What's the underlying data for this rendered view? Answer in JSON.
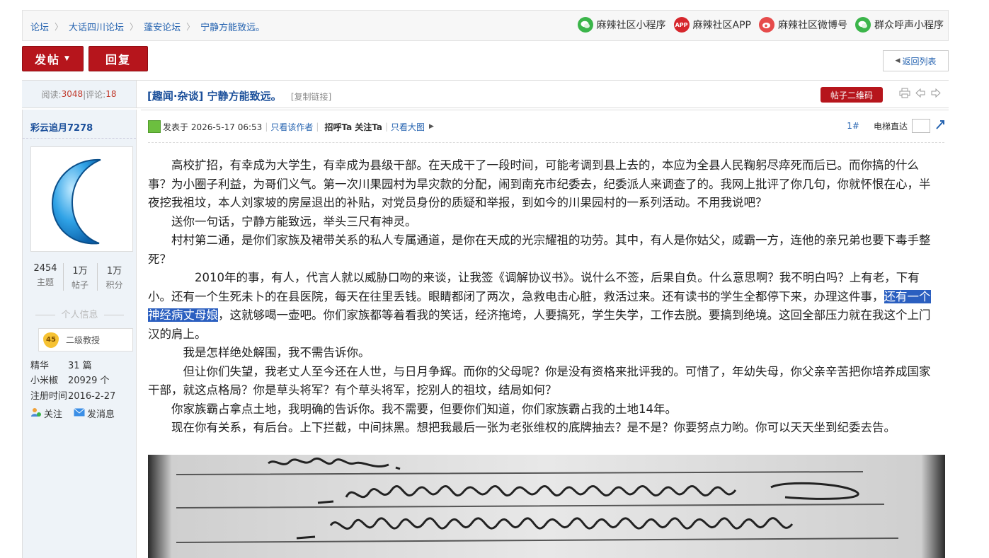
{
  "breadcrumb": [
    "论坛",
    "大话四川论坛",
    "蓬安论坛",
    "宁静方能致远。"
  ],
  "apps": [
    {
      "label": "麻辣社区小程序",
      "icon": "wechat-icon",
      "color": "#3bb54a"
    },
    {
      "label": "麻辣社区APP",
      "icon": "app-icon",
      "color": "#d6262c"
    },
    {
      "label": "麻辣社区微博号",
      "icon": "weibo-icon",
      "color": "#e64b4b"
    },
    {
      "label": "群众呼声小程序",
      "icon": "wechat-icon",
      "color": "#3bb54a"
    }
  ],
  "app_icon_text": "APP",
  "toolbar": {
    "post_label": "发帖",
    "reply_label": "回复",
    "back_label": "返回列表"
  },
  "thread": {
    "read_label": "阅读:",
    "read_count": "3048",
    "comment_label": "|评论:",
    "comment_count": "18",
    "title": "[趣闻·杂谈] 宁静方能致远。",
    "copy_link": "[复制链接]",
    "qr_label": "帖子二维码"
  },
  "user": {
    "name": "彩云追月7278",
    "stats": [
      {
        "value": "2454",
        "label": "主题"
      },
      {
        "value": "1万",
        "label": "帖子"
      },
      {
        "value": "1万",
        "label": "积分"
      }
    ],
    "info_title": "个人信息",
    "rank_level": "45",
    "rank_title": "二级教授",
    "fields": [
      {
        "key": "精华",
        "value": "31 篇"
      },
      {
        "key": "小米椒",
        "value": "20929 个"
      },
      {
        "key": "注册时间",
        "value": "2016-2-27"
      }
    ],
    "follow_label": "关注",
    "message_label": "发消息"
  },
  "post": {
    "posted_at": "发表于 2026-5-17 06:53",
    "only_author": "只看该作者",
    "greet": "招呼Ta",
    "follow": "关注Ta",
    "big_image": "只看大图",
    "floor": "1#",
    "elevator": "电梯直达",
    "paragraphs": [
      "　　高校扩招，有幸成为大学生，有幸成为县级干部。在天成干了一段时间，可能考调到县上去的，本应为全县人民鞠躬尽瘁死而后已。而你搞的什么事？为小圈子利益，为哥们义气。第一次川果园村为旱灾款的分配，闹到南充市纪委去，纪委派人来调查了的。我网上批评了你几句，你就怀恨在心，半夜挖我祖坟，本人刘家坡的房屋退出的补贴，对党员身份的质疑和举报，到如今的川果园村的一系列活动。不用我说吧？",
      "　　送你一句话，宁静方能致远，举头三尺有神灵。",
      "　　村村第二通，是你们家族及裙带关系的私人专属通道，是你在天成的光宗耀祖的功劳。其中，有人是你姑父，威霸一方，连他的亲兄弟也要下毒手整死？"
    ],
    "p4_before": "　　　　2010年的事，有人，代言人就以威胁口吻的来谈，让我签《调解协议书》。说什么不签，后果自负。什么意思啊？我不明白吗？上有老，下有小。还有一个生死未卜的在县医院，每天在往里丢钱。眼睛都闭了两次，急救电击心脏，救活过来。还有读书的学生全都停下来，办理这件事，",
    "p4_highlight": "还有一个神经病丈母娘",
    "p4_after": "，这就够喝一壶吧。你们家族都等着看我的笑话，经济拖垮，人要搞死，学生失学，工作去脱。要搞到绝境。这回全部压力就在我这个上门汉的肩上。",
    "paragraphs_after": [
      "　　　我是怎样绝处解围，我不需告诉你。",
      "　　　但让你们失望，我老丈人至今还在人世，与日月争辉。而你的父母呢？你是没有资格来批评我的。可惜了，年幼失母，你父亲辛苦把你培养成国家干部，就这点格局？你是草头将军？有个草头将军，挖别人的祖坟，结局如何？",
      "　　你家族霸占拿点土地，我明确的告诉你。我不需要，但要你们知道，你们家族霸占我的土地14年。",
      "　　现在你有关系，有后台。上下拦截，中间抹黑。想把我最后一张为老张维权的底牌抽去？是不是？你要努点力哟。你可以天天坐到纪委去告。"
    ]
  }
}
